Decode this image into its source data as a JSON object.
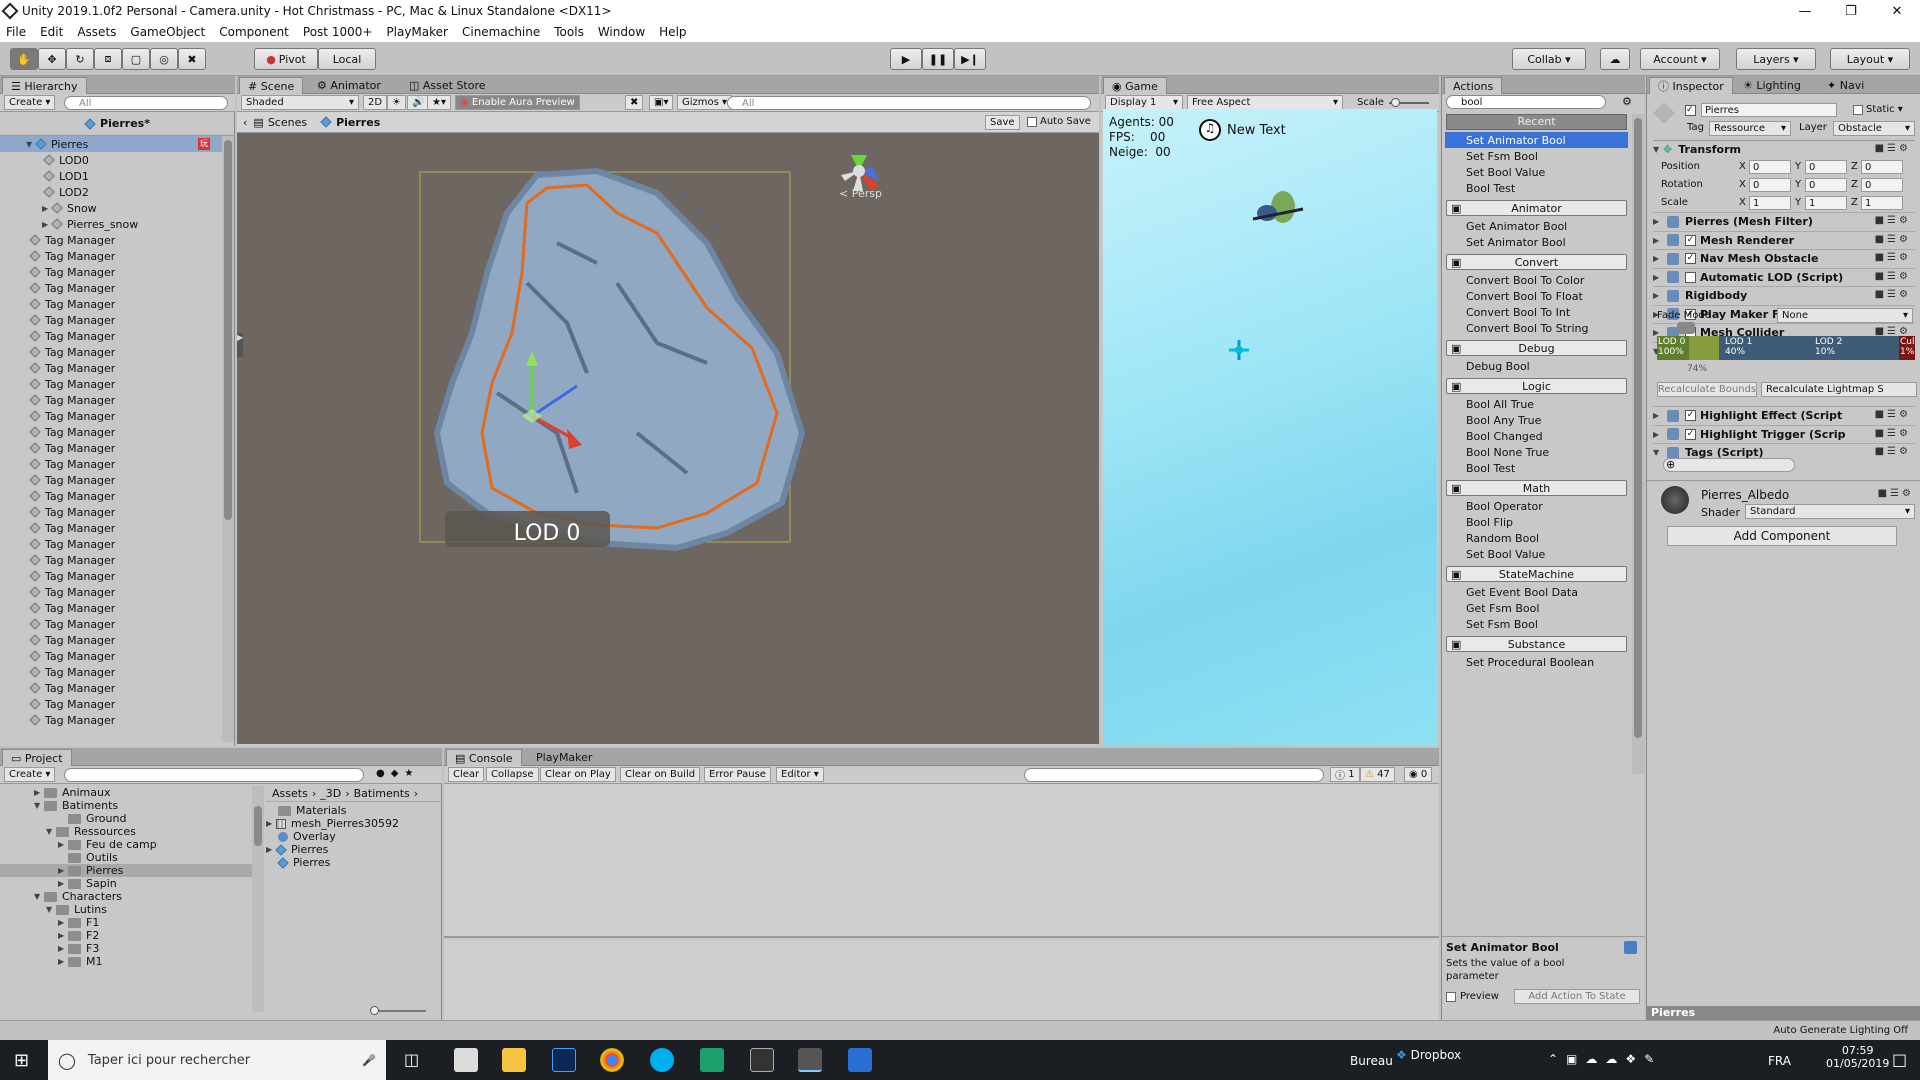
{
  "window": {
    "title": "Unity 2019.1.0f2 Personal - Camera.unity - Hot Christmass - PC, Mac & Linux Standalone <DX11>"
  },
  "menu": [
    "File",
    "Edit",
    "Assets",
    "GameObject",
    "Component",
    "Post 1000+",
    "PlayMaker",
    "Cinemachine",
    "Tools",
    "Window",
    "Help"
  ],
  "toolbar": {
    "pivot": "Pivot",
    "local": "Local",
    "collab": "Collab",
    "account": "Account",
    "layers": "Layers",
    "layout": "Layout"
  },
  "hierarchy": {
    "tab": "Hierarchy",
    "create": "Create",
    "search_placeholder": "All",
    "scene_name": "Pierres*",
    "items": [
      "Pierres",
      "LOD0",
      "LOD1",
      "LOD2",
      "Snow",
      "Pierres_snow",
      "Tag Manager",
      "Tag Manager",
      "Tag Manager",
      "Tag Manager",
      "Tag Manager",
      "Tag Manager",
      "Tag Manager",
      "Tag Manager",
      "Tag Manager",
      "Tag Manager",
      "Tag Manager",
      "Tag Manager",
      "Tag Manager",
      "Tag Manager",
      "Tag Manager",
      "Tag Manager",
      "Tag Manager",
      "Tag Manager",
      "Tag Manager",
      "Tag Manager",
      "Tag Manager",
      "Tag Manager",
      "Tag Manager",
      "Tag Manager",
      "Tag Manager",
      "Tag Manager",
      "Tag Manager",
      "Tag Manager",
      "Tag Manager",
      "Tag Manager",
      "Tag Manager"
    ]
  },
  "scene": {
    "tabs": [
      "Scene",
      "Animator",
      "Asset Store"
    ],
    "shading": "Shaded",
    "mode2d": "2D",
    "aura": "Enable Aura Preview",
    "gizmos": "Gizmos",
    "search_placeholder": "All",
    "crumb_scenes": "Scenes",
    "crumb_obj": "Pierres",
    "save": "Save",
    "autosave": "Auto Save",
    "persp": "< Persp",
    "lod_label": "LOD 0"
  },
  "game": {
    "tab": "Game",
    "display": "Display 1",
    "aspect": "Free Aspect",
    "scale": "Scale",
    "agents": "Agents: 00",
    "fps": "FPS:    00",
    "neige": "Neige:  00",
    "new_text": "New Text"
  },
  "actions": {
    "tab": "Actions",
    "search": "bool",
    "recent": "Recent",
    "groups": [
      {
        "name": "",
        "items": [
          "Set Animator Bool",
          "Set Fsm Bool",
          "Set Bool Value",
          "Bool Test"
        ]
      },
      {
        "name": "Animator",
        "items": [
          "Get Animator Bool",
          "Set Animator Bool"
        ]
      },
      {
        "name": "Convert",
        "items": [
          "Convert Bool To Color",
          "Convert Bool To Float",
          "Convert Bool To Int",
          "Convert Bool To String"
        ]
      },
      {
        "name": "Debug",
        "items": [
          "Debug Bool"
        ]
      },
      {
        "name": "Logic",
        "items": [
          "Bool All True",
          "Bool Any True",
          "Bool Changed",
          "Bool None True",
          "Bool Test"
        ]
      },
      {
        "name": "Math",
        "items": [
          "Bool Operator",
          "Bool Flip",
          "Random Bool",
          "Set Bool Value"
        ]
      },
      {
        "name": "StateMachine",
        "items": [
          "Get Event Bool Data",
          "Get Fsm Bool",
          "Set Fsm Bool"
        ]
      },
      {
        "name": "Substance",
        "items": [
          "Set Procedural Boolean"
        ]
      }
    ],
    "help_title": "Set Animator Bool",
    "help_text": "Sets the value of a bool parameter",
    "preview": "Preview",
    "add_action": "Add Action To State"
  },
  "inspector": {
    "tabs": [
      "Inspector",
      "Lighting",
      "Navi"
    ],
    "name": "Pierres",
    "static": "Static",
    "tag_label": "Tag",
    "tag": "Ressource",
    "layer_label": "Layer",
    "layer": "Obstacle",
    "transform": "Transform",
    "position": "Position",
    "rotation": "Rotation",
    "scale": "Scale",
    "pos": [
      "0",
      "0",
      "0"
    ],
    "rot": [
      "0",
      "0",
      "0"
    ],
    "scl": [
      "1",
      "1",
      "1"
    ],
    "components": [
      "Pierres (Mesh Filter)",
      "Mesh Renderer",
      "Nav Mesh Obstacle",
      "Automatic LOD (Script)",
      "Rigidbody",
      "Play Maker FSM (Script",
      "Mesh Collider",
      "LOD Group"
    ],
    "fade_mode_label": "Fade Mode",
    "fade_mode": "None",
    "lod": [
      {
        "name": "LOD 0",
        "pct": "100%"
      },
      {
        "name": "LOD 1",
        "pct": "40%"
      },
      {
        "name": "LOD 2",
        "pct": "10%"
      },
      {
        "name": "Cul",
        "pct": "1%"
      }
    ],
    "lod_marker": "74%",
    "recalc_bounds": "Recalculate Bounds",
    "recalc_lightmap": "Recalculate Lightmap S",
    "components2": [
      "Highlight Effect (Script",
      "Highlight Trigger (Scrip",
      "Tags (Script)"
    ],
    "material": "Pierres_Albedo",
    "shader_label": "Shader",
    "shader": "Standard",
    "add_component": "Add Component",
    "footer": "Pierres"
  },
  "project": {
    "tab": "Project",
    "create": "Create",
    "tree": [
      "Animaux",
      "Batiments",
      "Ground",
      "Ressources",
      "Feu de camp",
      "Outils",
      "Pierres",
      "Sapin",
      "Characters",
      "Lutins",
      "F1",
      "F2",
      "F3",
      "M1"
    ],
    "crumbs": [
      "Assets",
      "_3D",
      "Batiments"
    ],
    "files": [
      "Materials",
      "mesh_Pierres30592",
      "Overlay",
      "Pierres",
      "Pierres"
    ]
  },
  "console": {
    "tabs": [
      "Console",
      "PlayMaker"
    ],
    "buttons": [
      "Clear",
      "Collapse",
      "Clear on Play",
      "Clear on Build",
      "Error Pause",
      "Editor"
    ],
    "info": "1",
    "warn": "47",
    "err": "0"
  },
  "status": {
    "lighting": "Auto Generate Lighting Off"
  },
  "taskbar": {
    "search": "Taper ici pour rechercher",
    "bureau": "Bureau",
    "dropbox": "Dropbox",
    "lang": "FRA",
    "time": "07:59",
    "date": "01/05/2019"
  }
}
